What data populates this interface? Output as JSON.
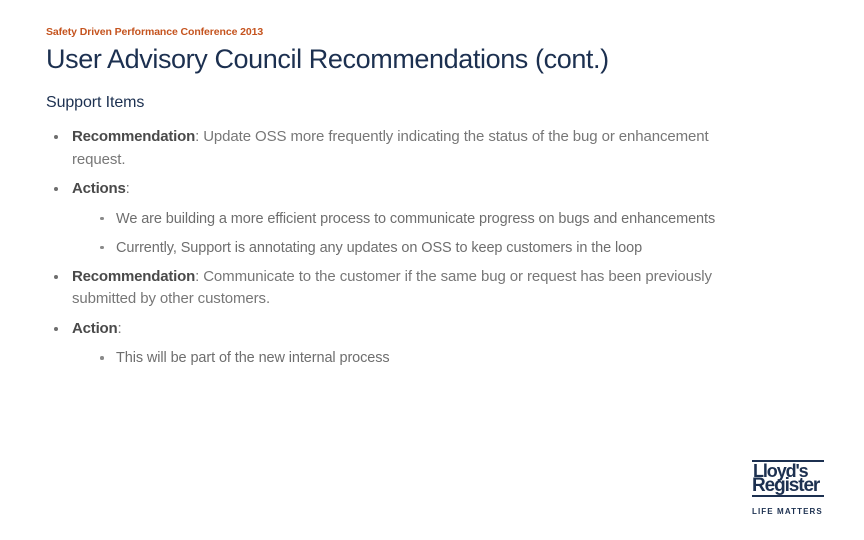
{
  "slide": {
    "eyebrow": "Safety Driven Performance Conference 2013",
    "title": "User Advisory Council Recommendations (cont.)",
    "section_heading": "Support Items",
    "colors": {
      "eyebrow": "#c5541f",
      "title": "#1c3050",
      "body_text": "#777777",
      "lead_text": "#4a4a4a",
      "bullet": "#6e6e6e",
      "background": "#ffffff"
    }
  },
  "bullets": [
    {
      "lead": "Recommendation",
      "rest": ": Update OSS more frequently indicating the status of the bug or enhancement request.",
      "children": []
    },
    {
      "lead": "Actions",
      "rest": ":",
      "children": [
        "We are building a more efficient process to communicate progress on bugs and enhancements",
        "Currently, Support is annotating any updates on OSS to keep customers in the loop"
      ]
    },
    {
      "lead": " Recommendation",
      "rest": ": Communicate to the customer if the same bug or request has been previously submitted by other customers.",
      "children": []
    },
    {
      "lead": "Action",
      "rest": ":",
      "children": [
        "This will be part of the new internal process"
      ]
    }
  ],
  "logo": {
    "line1": "Lloyd's",
    "line2": "Register",
    "tagline": "LIFE MATTERS"
  }
}
